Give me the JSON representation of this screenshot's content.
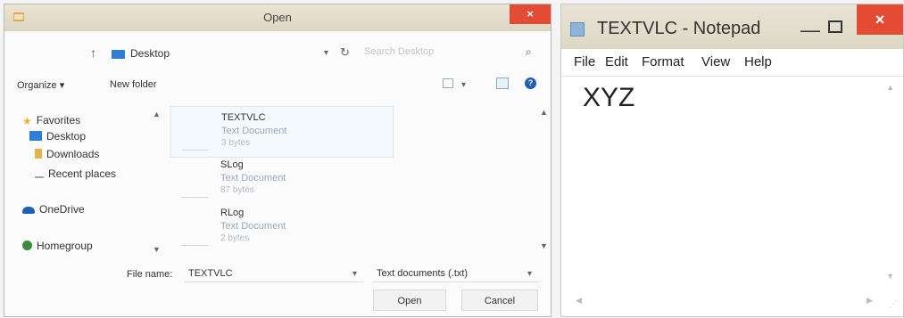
{
  "open_dialog": {
    "title": "Open",
    "close_label": "×",
    "address": {
      "up_icon": "up-arrow-icon",
      "location": "Desktop",
      "search_placeholder": "Search Desktop"
    },
    "toolbar": {
      "organize_label": "Organize ▾",
      "new_folder_label": "New folder"
    },
    "nav": [
      {
        "label": "Favorites",
        "icon": "star-icon",
        "color": "#e8b52a"
      },
      {
        "label": "Desktop",
        "icon": "desktop-folder-icon",
        "color": "#2f7fd6"
      },
      {
        "label": "Downloads",
        "icon": "downloads-icon",
        "color": "#2f7fd6"
      },
      {
        "label": "Recent places",
        "icon": "recent-places-icon",
        "color": "#9aa"
      },
      {
        "label": "OneDrive",
        "icon": "cloud-icon",
        "color": "#1f5fb8"
      },
      {
        "label": "Homegroup",
        "icon": "homegroup-icon",
        "color": "#3a8d3a"
      }
    ],
    "files": [
      {
        "name": "TEXTVLC",
        "type": "Text Document",
        "size": "3 bytes"
      },
      {
        "name": "SLog",
        "type": "Text Document",
        "size": "87 bytes"
      },
      {
        "name": "RLog",
        "type": "Text Document",
        "size": "2 bytes"
      }
    ],
    "file_name_label": "File name:",
    "file_name_value": "TEXTVLC",
    "file_type_value": "Text documents (.txt)",
    "open_button": "Open",
    "cancel_button": "Cancel"
  },
  "notepad": {
    "title": "TEXTVLC - Notepad",
    "close_label": "×",
    "menu": [
      "File",
      "Edit",
      "Format",
      "View",
      "Help"
    ],
    "content": "XYZ"
  },
  "colors": {
    "close_red": "#e44b34",
    "link_blue": "#1f5fb8",
    "titlebar": "#e6e1cf"
  }
}
